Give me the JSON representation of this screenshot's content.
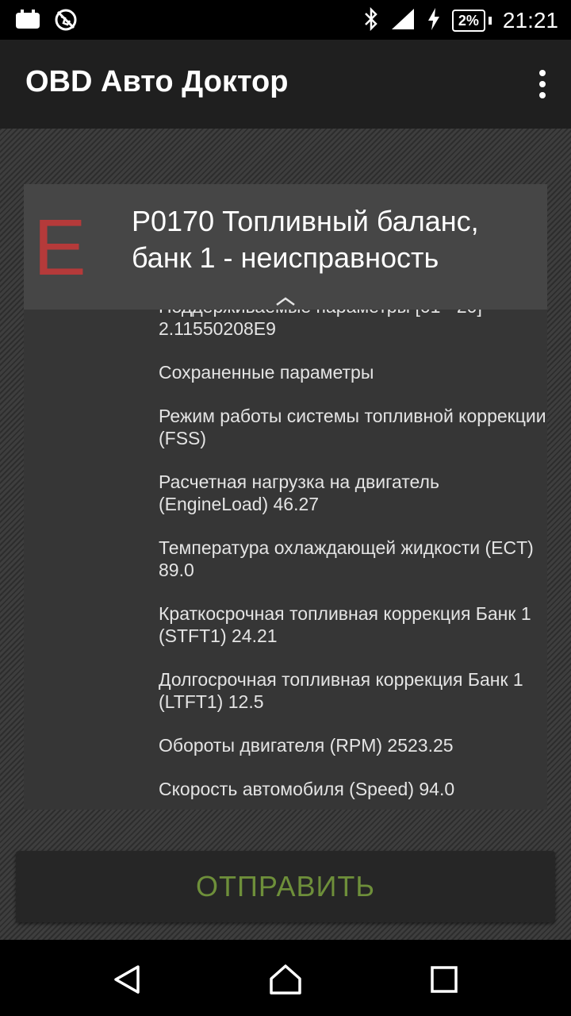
{
  "status_bar": {
    "battery_percent": "2%",
    "time": "21:21",
    "icons": [
      "notification-icon",
      "no-location-icon",
      "bluetooth-icon",
      "signal-icon",
      "charging-icon",
      "battery-icon"
    ]
  },
  "app_bar": {
    "title": "OBD Авто Доктор",
    "menu_icon": "overflow-menu-icon"
  },
  "error_card": {
    "severity_letter": "E",
    "severity_color": "#b53a3a",
    "code_title": "P0170 Топливный баланс, банк 1 - неисправность",
    "expand_icon": "chevron-up-icon",
    "parameters": [
      {
        "title": "Поддерживаемые параметры [01 - 20]",
        "value": "2.11550208E9"
      },
      {
        "title": "Сохраненные параметры",
        "value": ""
      },
      {
        "title": "Режим работы системы топливной коррекции (FSS)",
        "value": ""
      },
      {
        "title": "Расчетная нагрузка на двигатель (EngineLoad) 46.27",
        "value": ""
      },
      {
        "title": "Температура охлаждающей жидкости (ECT) 89.0",
        "value": ""
      },
      {
        "title": "Краткосрочная топливная коррекция Банк 1 (STFT1) 24.21",
        "value": ""
      },
      {
        "title": "Долгосрочная топливная коррекция Банк 1 (LTFT1) 12.5",
        "value": ""
      },
      {
        "title": "Обороты двигателя (RPM) 2523.25",
        "value": ""
      },
      {
        "title": "Скорость автомобиля (Speed) 94.0",
        "value": ""
      }
    ]
  },
  "send_button": {
    "label": "ОТПРАВИТЬ",
    "color": "#6e8f3a"
  },
  "nav_bar": {
    "icons": [
      "back-icon",
      "home-icon",
      "recents-icon"
    ]
  }
}
